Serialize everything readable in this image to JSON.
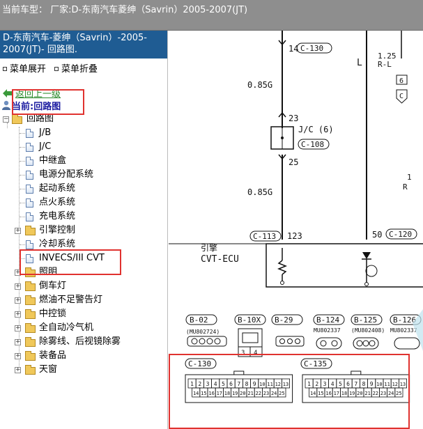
{
  "topbar": {
    "title": "当前车型：  厂家:D-东南汽车菱绅（Savrin）2005-2007(JT)"
  },
  "left": {
    "header": "D-东南汽车-菱绅（Savrin）-2005-2007(JT)- 回路图.",
    "menu_expand": "菜单展开",
    "menu_collapse": "菜单折叠",
    "back": "返回上一级",
    "current": "当前:回路图",
    "tree": [
      {
        "label": "回路图",
        "type": "folder-root"
      },
      {
        "label": "J/B",
        "type": "doc"
      },
      {
        "label": "J/C",
        "type": "doc"
      },
      {
        "label": "中继盒",
        "type": "doc"
      },
      {
        "label": "电源分配系统",
        "type": "doc"
      },
      {
        "label": "起动系统",
        "type": "doc"
      },
      {
        "label": "点火系统",
        "type": "doc"
      },
      {
        "label": "充电系统",
        "type": "doc"
      },
      {
        "label": "引擎控制",
        "type": "folder"
      },
      {
        "label": "冷却系统",
        "type": "doc"
      },
      {
        "label": "INVECS/III CVT",
        "type": "doc"
      },
      {
        "label": "照明",
        "type": "folder"
      },
      {
        "label": "倒车灯",
        "type": "folder"
      },
      {
        "label": "燃油不足警告灯",
        "type": "folder"
      },
      {
        "label": "中控锁",
        "type": "folder"
      },
      {
        "label": "全自动冷气机",
        "type": "folder"
      },
      {
        "label": "除雾线、后视镜除雾",
        "type": "folder"
      },
      {
        "label": "装备品",
        "type": "folder"
      },
      {
        "label": "天窗",
        "type": "folder"
      }
    ]
  },
  "diagram": {
    "wire_14": "14",
    "c130_top": "C-130",
    "wire_l": "L",
    "wire_125": "1.25",
    "wire_rl": "R-L",
    "pin_6": "6",
    "pin_c": "C",
    "wire_085g_1": "0.85G",
    "pin_23": "23",
    "jc6": "J/C (6)",
    "c108": "C-108",
    "pin_25": "25",
    "wire_085g_2": "0.85G",
    "c113": "C-113",
    "pin_123": "123",
    "pin_50": "50",
    "c120": "C-120",
    "ecu_1": "引擎",
    "ecu_2": "CVT-ECU",
    "conn_labels": [
      "B-02",
      "B-10X",
      "B-29",
      "B-124",
      "B-125",
      "B-126"
    ],
    "conn_parts": [
      "(MU802724)",
      "MU802337",
      "(MU802408)",
      "MU802337"
    ],
    "c130_bottom": "C-130",
    "c135": "C-135",
    "c130_row1": [
      "1",
      "2",
      "3",
      "4",
      "5",
      "6",
      "7",
      "8",
      "9",
      "10",
      "11",
      "12",
      "13"
    ],
    "c130_row2": [
      "14",
      "15",
      "16",
      "17",
      "18",
      "19",
      "20",
      "21",
      "22",
      "23",
      "24",
      "25"
    ],
    "c135_row1": [
      "1",
      "2",
      "3",
      "4",
      "5",
      "6",
      "7",
      "8",
      "9",
      "10",
      "11",
      "12",
      "13"
    ],
    "c135_row2": [
      "14",
      "15",
      "16",
      "17",
      "18",
      "19",
      "20",
      "21",
      "22",
      "23",
      "24",
      "25"
    ],
    "b10x_pins": [
      "3",
      "4"
    ],
    "right_r": "R",
    "right_1": "1"
  }
}
